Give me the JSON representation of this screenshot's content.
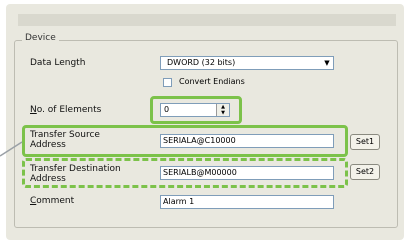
{
  "group": {
    "title": "Device"
  },
  "fields": {
    "data_length": {
      "label": "Data Length",
      "value": "DWORD (32 bits)"
    },
    "convert_endians": {
      "label": "Convert Endians",
      "checked": false
    },
    "no_of_elements": {
      "label_prefix": "N",
      "label_rest": "o. of Elements",
      "value": "0"
    },
    "transfer_source": {
      "label_line1": "Transfer Source",
      "label_line2": "Address",
      "value": "SERIALA@C10000",
      "button": "Set1"
    },
    "transfer_destination": {
      "label_line1": "Transfer Destination",
      "label_line2": "Address",
      "value": "SERIALB@M00000",
      "button": "Set2"
    },
    "comment": {
      "label_prefix": "C",
      "label_rest": "omment",
      "value": "Alarm 1"
    }
  },
  "icons": {
    "dropdown": "chevron-down-icon",
    "spin_up": "spin-up-icon",
    "spin_down": "spin-down-icon"
  },
  "colors": {
    "highlight": "#7cc24a",
    "panel": "#e9e8df",
    "input_border": "#7f9db9"
  }
}
